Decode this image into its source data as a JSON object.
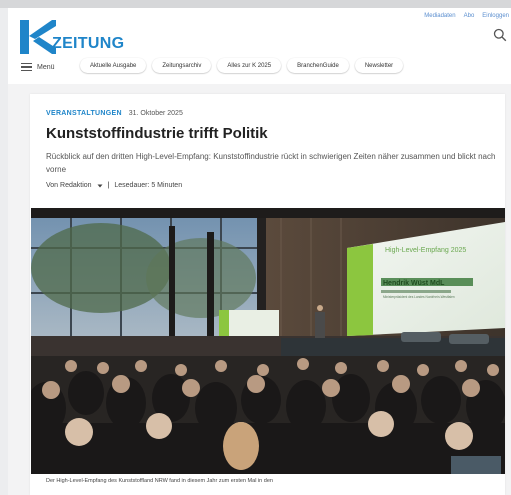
{
  "top_links": [
    "Mediadaten",
    "Abo",
    "Einloggen"
  ],
  "logo": {
    "text": "ZEITUNG",
    "brand_color": "#1f85c9"
  },
  "menu": {
    "label": "Menü"
  },
  "nav": [
    {
      "label": "Aktuelle Ausgabe"
    },
    {
      "label": "Zeitungsarchiv"
    },
    {
      "label": "Alles zur K 2025"
    },
    {
      "label": "BranchenGuide"
    },
    {
      "label": "Newsletter"
    }
  ],
  "article": {
    "category": "VERANSTALTUNGEN",
    "date": "31. Oktober 2025",
    "title": "Kunststoffindustrie trifft Politik",
    "subtitle": "Rückblick auf den dritten High-Level-Empfang: Kunststoffindustrie rückt in schwierigen Zeiten näher zusammen und blickt nach vorne",
    "author": "Von Redaktion",
    "separator": "|",
    "reading_time": "Lesedauer: 5 Minuten",
    "caption": "Der High-Level-Empfang des Kunststoffland NRW fand in diesem Jahr zum ersten Mal in den",
    "screen_header": "High-Level-Empfang 2025",
    "speaker_name": "Hendrik Wüst MdL",
    "speaker_role": "Ministerpräsident des Landes Nordrhein-Westfalen"
  },
  "icons": {
    "search": "search-icon",
    "menu": "hamburger-icon",
    "dropdown": "chevron-down-icon"
  }
}
